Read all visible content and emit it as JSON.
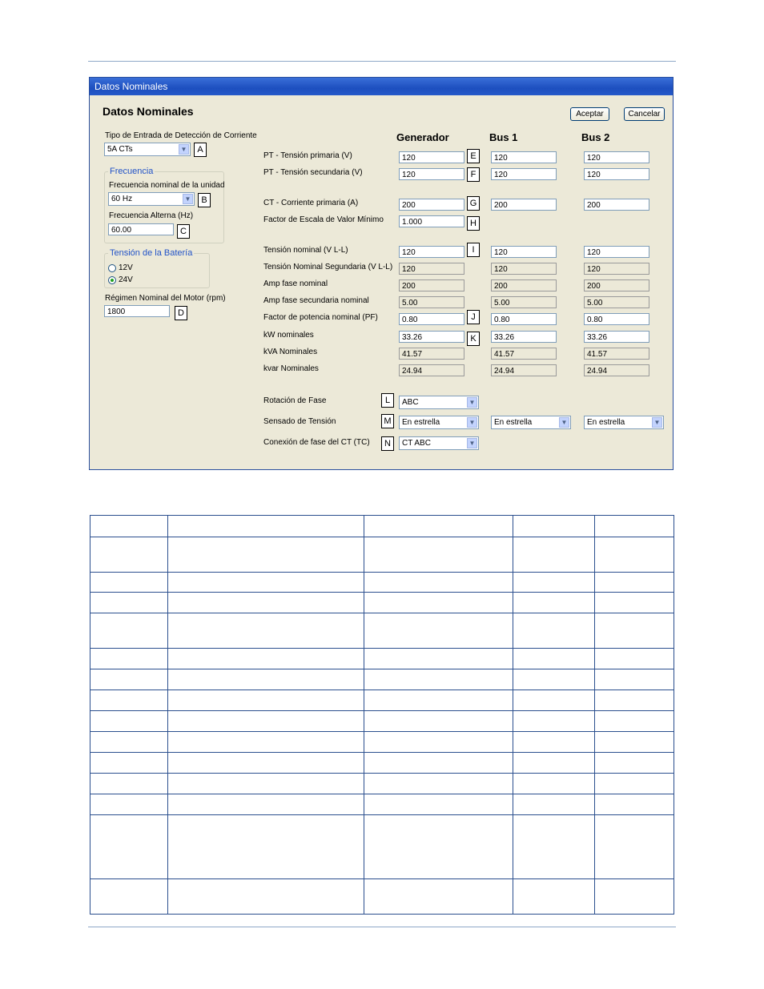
{
  "dialog": {
    "window_title": "Datos Nominales",
    "heading": "Datos Nominales",
    "ok_label": "Aceptar",
    "cancel_label": "Cancelar"
  },
  "left": {
    "current_input_label": "Tipo de Entrada de Detección de Corriente",
    "current_input_value": "5A CTs",
    "tag_a": "A",
    "freq_group_title": "Frecuencia",
    "nominal_freq_label": "Frecuencia nominal de la unidad",
    "nominal_freq_value": "60 Hz",
    "tag_b": "B",
    "alt_freq_label": "Frecuencia Alterna (Hz)",
    "alt_freq_value": "60.00",
    "tag_c": "C",
    "battery_group_title": "Tensión de la Batería",
    "battery_12v": "12V",
    "battery_24v": "24V",
    "motor_label": "Régimen Nominal del Motor (rpm)",
    "motor_value": "1800",
    "tag_d": "D"
  },
  "columns": {
    "generator": "Generador",
    "bus1": "Bus 1",
    "bus2": "Bus 2"
  },
  "rows": {
    "pt_primary": {
      "label": "PT - Tensión primaria (V)",
      "tag": "E",
      "gen": "120",
      "bus1": "120",
      "bus2": "120"
    },
    "pt_secondary": {
      "label": "PT - Tensión secundaria (V)",
      "tag": "F",
      "gen": "120",
      "bus1": "120",
      "bus2": "120"
    },
    "ct_primary": {
      "label": "CT - Corriente primaria (A)",
      "tag": "G",
      "gen": "200",
      "bus1": "200",
      "bus2": "200"
    },
    "min_scale": {
      "label": "Factor de Escala de Valor Mínimo",
      "tag": "H",
      "gen": "1.000"
    },
    "nominal_voltage": {
      "label": "Tensión nominal (V L-L)",
      "tag": "I",
      "gen": "120",
      "bus1": "120",
      "bus2": "120"
    },
    "nominal_sec_voltage": {
      "label": "Tensión Nominal Segundaria (V L-L)",
      "gen": "120",
      "bus1": "120",
      "bus2": "120"
    },
    "amp_phase": {
      "label": "Amp fase nominal",
      "gen": "200",
      "bus1": "200",
      "bus2": "200"
    },
    "amp_phase_sec": {
      "label": "Amp fase secundaria nominal",
      "gen": "5.00",
      "bus1": "5.00",
      "bus2": "5.00"
    },
    "pf": {
      "label": "Factor de potencia nominal (PF)",
      "tag": "J",
      "gen": "0.80",
      "bus1": "0.80",
      "bus2": "0.80"
    },
    "kw": {
      "label": "kW nominales",
      "tag": "K",
      "gen": "33.26",
      "bus1": "33.26",
      "bus2": "33.26"
    },
    "kva": {
      "label": "kVA Nominales",
      "gen": "41.57",
      "bus1": "41.57",
      "bus2": "41.57"
    },
    "kvar": {
      "label": "kvar Nominales",
      "gen": "24.94",
      "bus1": "24.94",
      "bus2": "24.94"
    }
  },
  "selects": {
    "phase_rotation": {
      "label": "Rotación de Fase",
      "tag": "L",
      "gen": "ABC"
    },
    "voltage_sensing": {
      "label": "Sensado de Tensión",
      "tag": "M",
      "gen": "En estrella",
      "bus1": "En estrella",
      "bus2": "En estrella"
    },
    "ct_connection": {
      "label": "Conexión de fase del CT (TC)",
      "tag": "N",
      "gen": "CT ABC"
    }
  }
}
